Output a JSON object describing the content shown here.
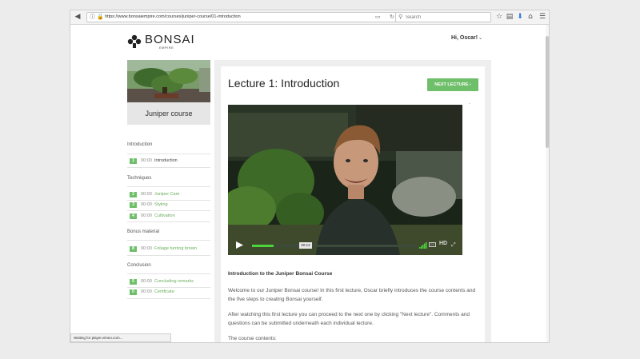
{
  "browser": {
    "url": "https://www.bonsaiempire.com/courses/juniper-course/01-introduction",
    "search_placeholder": "Search",
    "status_text": "Waiting for player.vimeo.com..."
  },
  "site": {
    "logo_name": "BONSAI",
    "logo_sub": "EMPIRE",
    "greeting": "Hi, Oscar!"
  },
  "sidebar": {
    "course_name": "Juniper course",
    "sections": [
      {
        "title": "Introduction",
        "lessons": [
          {
            "num": "1",
            "time": "00:00",
            "title": "Introduction",
            "current": true
          }
        ]
      },
      {
        "title": "Techniques",
        "lessons": [
          {
            "num": "2",
            "time": "00:00",
            "title": "Juniper Care"
          },
          {
            "num": "3",
            "time": "00:00",
            "title": "Styling"
          },
          {
            "num": "4",
            "time": "00:00",
            "title": "Cultivation"
          }
        ]
      },
      {
        "title": "Bonus material",
        "lessons": [
          {
            "num": "8",
            "time": "00:00",
            "title": "Foliage turning brown"
          }
        ]
      },
      {
        "title": "Conclusion",
        "lessons": [
          {
            "num": "5",
            "time": "00:00",
            "title": "Concluding remarks"
          },
          {
            "num": "0",
            "time": "00:00",
            "title": "Certificate"
          }
        ]
      }
    ]
  },
  "main": {
    "lecture_title": "Lecture 1: Introduction",
    "next_label": "NEXT LECTURE ›",
    "dash": "-",
    "video": {
      "time": "00:13",
      "progress": 0.13,
      "hd_label": "HD",
      "cc_label": "CC"
    },
    "description": {
      "heading": "Introduction to the Juniper Bonsai Course",
      "p1": "Welcome to our Juniper Bonsai course! In this first lecture, Oscar briefly introduces the course contents and the five steps to creating Bonsai yourself.",
      "p2": "After watching this first lecture you can proceed to the next one by clicking \"Next lecture\". Comments and questions can be submitted underneath each individual lecture.",
      "p3": "The course contents:"
    }
  },
  "colors": {
    "accent": "#6fbf6a",
    "progress": "#4bd43b"
  }
}
